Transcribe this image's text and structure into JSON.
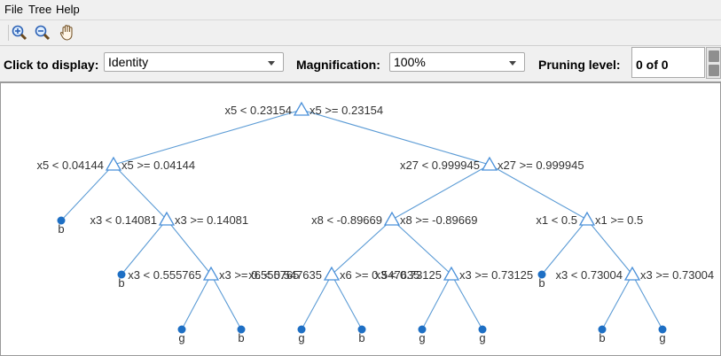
{
  "menu": [
    "File",
    "Tree",
    "Help"
  ],
  "toolbar": {
    "icons": [
      "zoom-in-icon",
      "zoom-out-icon",
      "pan-hand-icon"
    ]
  },
  "controls": {
    "click_label": "Click to display:",
    "click_value": "Identity",
    "mag_label": "Magnification:",
    "mag_value": "100%",
    "prune_label": "Pruning level:",
    "prune_value": "0 of 0"
  },
  "colors": {
    "accent": "#4a90d9",
    "leaf": "#1e6fc4",
    "edge": "#5b9bd5"
  },
  "tree": {
    "nodes": [
      {
        "id": "root",
        "type": "branch",
        "left": "x5 < 0.23154",
        "right": "x5 >= 0.23154"
      },
      {
        "id": "n1",
        "type": "branch",
        "left": "x5 < 0.04144",
        "right": "x5 >= 0.04144"
      },
      {
        "id": "n2",
        "type": "branch",
        "left": "x27 < 0.999945",
        "right": "x27 >= 0.999945"
      },
      {
        "id": "n3",
        "type": "leaf",
        "label": "b"
      },
      {
        "id": "n4",
        "type": "branch",
        "left": "x3 < 0.14081",
        "right": "x3 >= 0.14081"
      },
      {
        "id": "n5",
        "type": "branch",
        "left": "x8 < -0.89669",
        "right": "x8 >= -0.89669"
      },
      {
        "id": "n6",
        "type": "branch",
        "left": "x1 < 0.5",
        "right": "x1 >= 0.5"
      },
      {
        "id": "n7",
        "type": "leaf",
        "label": "b"
      },
      {
        "id": "n8",
        "type": "branch",
        "left": "x3 < 0.555765",
        "right": "x3 >= 0.555765"
      },
      {
        "id": "n9",
        "type": "branch",
        "left": "x6 < 0.547635",
        "right": "x6 >= 0.547635"
      },
      {
        "id": "n10",
        "type": "branch",
        "left": "x3 < 0.73125",
        "right": "x3 >= 0.73125"
      },
      {
        "id": "n11",
        "type": "leaf",
        "label": "b"
      },
      {
        "id": "n12",
        "type": "branch",
        "left": "x3 < 0.73004",
        "right": "x3 >= 0.73004"
      },
      {
        "id": "n13",
        "type": "leaf",
        "label": "g"
      },
      {
        "id": "n14",
        "type": "leaf",
        "label": "b"
      },
      {
        "id": "n15",
        "type": "leaf",
        "label": "g"
      },
      {
        "id": "n16",
        "type": "leaf",
        "label": "b"
      },
      {
        "id": "n17",
        "type": "leaf",
        "label": "g"
      },
      {
        "id": "n18",
        "type": "leaf",
        "label": "g"
      },
      {
        "id": "n19",
        "type": "leaf",
        "label": "b"
      },
      {
        "id": "n20",
        "type": "leaf",
        "label": "g"
      }
    ],
    "edges": [
      [
        "root",
        "n1"
      ],
      [
        "root",
        "n2"
      ],
      [
        "n1",
        "n3"
      ],
      [
        "n1",
        "n4"
      ],
      [
        "n2",
        "n5"
      ],
      [
        "n2",
        "n6"
      ],
      [
        "n4",
        "n7"
      ],
      [
        "n4",
        "n8"
      ],
      [
        "n5",
        "n9"
      ],
      [
        "n5",
        "n10"
      ],
      [
        "n6",
        "n11"
      ],
      [
        "n6",
        "n12"
      ],
      [
        "n8",
        "n13"
      ],
      [
        "n8",
        "n14"
      ],
      [
        "n9",
        "n15"
      ],
      [
        "n9",
        "n16"
      ],
      [
        "n10",
        "n17"
      ],
      [
        "n10",
        "n18"
      ],
      [
        "n12",
        "n19"
      ],
      [
        "n12",
        "n20"
      ]
    ]
  }
}
